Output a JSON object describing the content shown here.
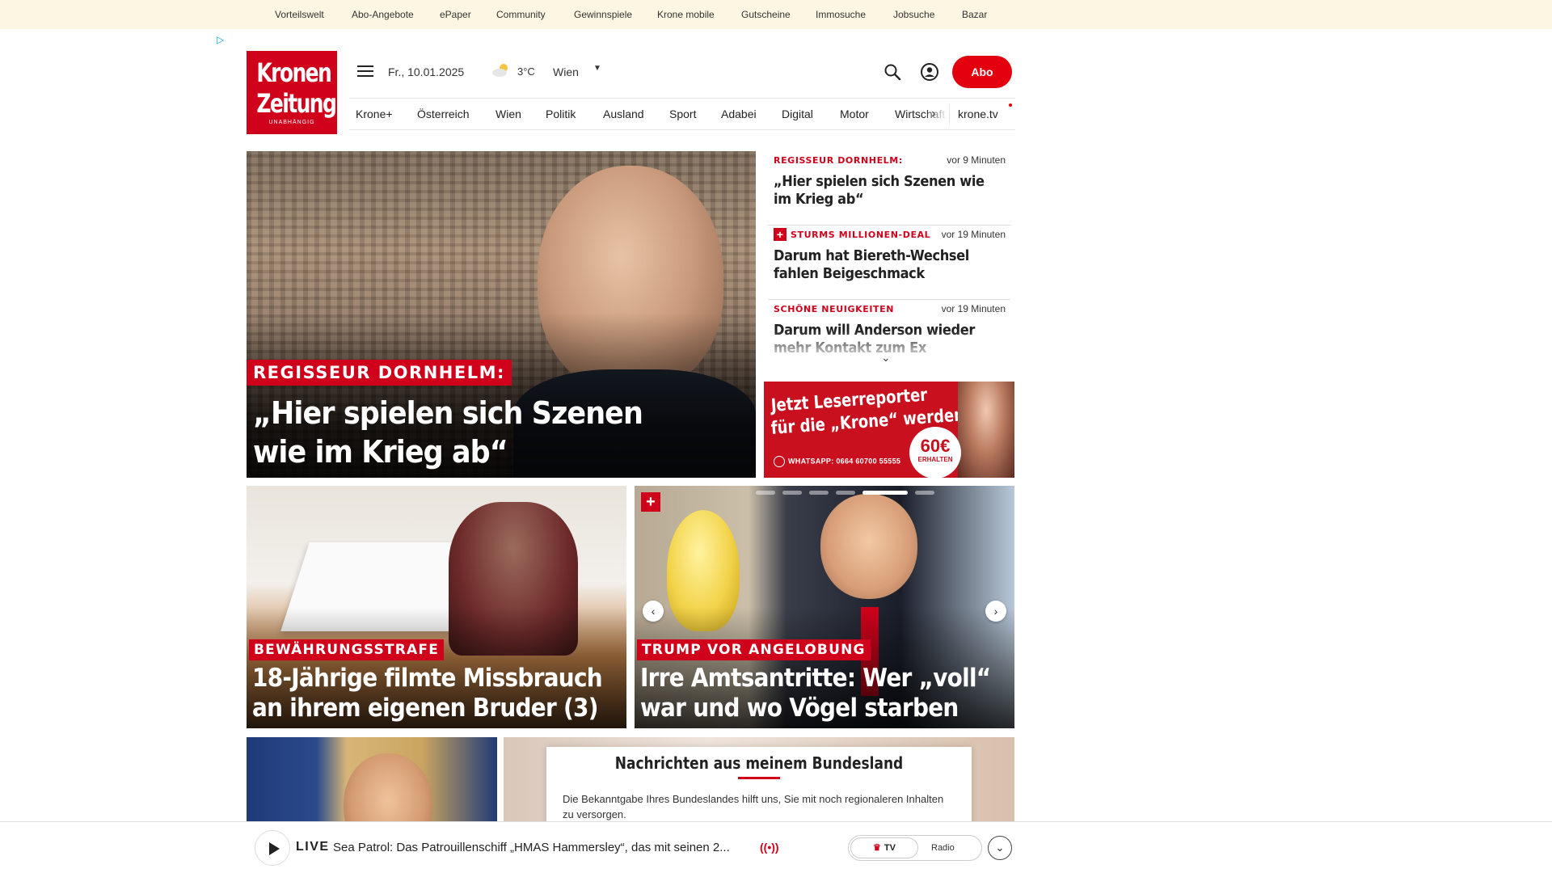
{
  "topbar": {
    "links": [
      "Vorteilswelt",
      "Abo-Angebote",
      "ePaper",
      "Community",
      "Gewinnspiele",
      "Krone mobile",
      "Gutscheine",
      "Immosuche",
      "Jobsuche",
      "Bazar"
    ]
  },
  "logo": {
    "line1": "Kronen",
    "line2": "Zeitung",
    "line3": "UNABHÄNGIG"
  },
  "header": {
    "date": "Fr., 10.01.2025",
    "temperature": "3°C",
    "city": "Wien",
    "abo_label": "Abo",
    "weather_icon": "partly-cloudy-icon",
    "accent_color": "#e3000f"
  },
  "nav": {
    "items": [
      "Krone+",
      "Österreich",
      "Wien",
      "Politik",
      "Ausland",
      "Sport",
      "Adabei",
      "Digital",
      "Motor",
      "Wirtschaft"
    ],
    "tv_label": "krone.tv"
  },
  "hero": {
    "kicker": "REGISSEUR DORNHELM:",
    "title": "„Hier spielen sich Szenen wie im Krieg ab“"
  },
  "ticker": {
    "items": [
      {
        "kicker": "REGISSEUR DORNHELM:",
        "time": "vor 9 Minuten",
        "title": "„Hier spielen sich Szenen wie im Krieg ab“",
        "plus": false
      },
      {
        "kicker": "STURMS MILLIONEN-DEAL",
        "time": "vor 19 Minuten",
        "title": "Darum hat Biereth-Wechsel fahlen Beigeschmack",
        "plus": true
      },
      {
        "kicker": "SCHÖNE NEUIGKEITEN",
        "time": "vor 19 Minuten",
        "title": "Darum will Anderson wieder mehr Kontakt zum Ex",
        "plus": false
      }
    ]
  },
  "ad_leserreporter": {
    "line1": "Jetzt Leserreporter",
    "line2": "für die „Krone“ werden",
    "whatsapp": "WHATSAPP: 0664 60700 55555",
    "badge_amount": "60€",
    "badge_text": "ERHALTEN"
  },
  "cards": [
    {
      "kicker": "BEWÄHRUNGSSTRAFE",
      "title": "18-Jährige filmte Missbrauch an ihrem eigenen Bruder (3)"
    },
    {
      "kicker": "TRUMP VOR ANGELOBUNG",
      "title": "Irre Amtsantritte: Wer „voll“ war und wo Vögel starben",
      "slide_active": 4,
      "slide_count": 6
    }
  ],
  "bundesland": {
    "title": "Nachrichten aus meinem Bundesland",
    "text": "Die Bekanntgabe Ihres Bundeslandes hilft uns, Sie mit noch regionaleren Inhalten zu versorgen."
  },
  "player": {
    "live_label": "LIVE",
    "show_title": "Sea Patrol: Das Patrouillenschiff „HMAS Hammersley“, das mit seinen 2...",
    "tv_label": "TV",
    "radio_label": "Radio"
  }
}
